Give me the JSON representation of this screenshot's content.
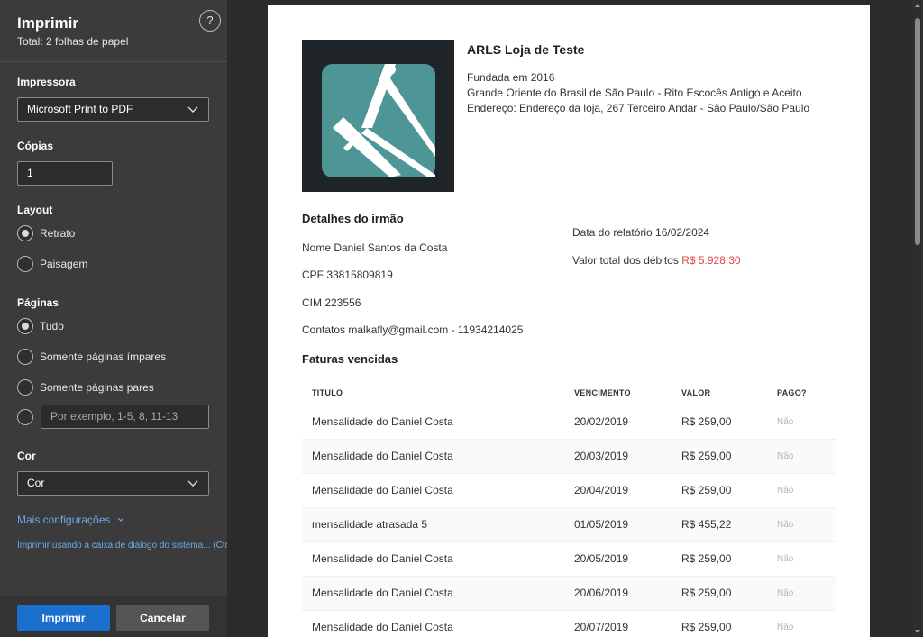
{
  "panel": {
    "title": "Imprimir",
    "subtitle": "Total: 2 folhas de papel",
    "help_icon": "?",
    "printer_label": "Impressora",
    "printer_value": "Microsoft Print to PDF",
    "copies_label": "Cópias",
    "copies_value": "1",
    "layout_label": "Layout",
    "layout_options": [
      "Retrato",
      "Paisagem"
    ],
    "layout_selected": "Retrato",
    "pages_label": "Páginas",
    "pages_options": [
      "Tudo",
      "Somente páginas ímpares",
      "Somente páginas pares"
    ],
    "pages_selected": "Tudo",
    "pages_custom_placeholder": "Por exemplo, 1-5, 8, 11-13",
    "color_label": "Cor",
    "color_value": "Cor",
    "more_settings": "Mais configurações",
    "system_dialog_link": "Imprimir usando a caixa de diálogo do sistema... (Ctrl+Shift+P)",
    "print_button": "Imprimir",
    "cancel_button": "Cancelar"
  },
  "document": {
    "org_name": "ARLS Loja de Teste",
    "founded": "Fundada em 2016",
    "obedience": "Grande Oriente do Brasil de São Paulo - Rito Escocês Antigo e Aceito",
    "address": "Endereço: Endereço da loja, 267 Terceiro Andar - São Paulo/São Paulo",
    "details_title": "Detalhes do irmão",
    "name": "Nome Daniel Santos da Costa",
    "cpf": "CPF 33815809819",
    "cim": "CIM 223556",
    "contacts": "Contatos malkafly@gmail.com - 11934214025",
    "report_date": "Data do relatório 16/02/2024",
    "total_debts_label": "Valor total dos débitos",
    "total_debts_value": "R$ 5.928,30",
    "overdue_title": "Faturas vencidas",
    "table": {
      "headers": [
        "TITULO",
        "VENCIMENTO",
        "VALOR",
        "PAGO?"
      ],
      "rows": [
        [
          "Mensalidade do Daniel Costa",
          "20/02/2019",
          "R$ 259,00",
          "Não"
        ],
        [
          "Mensalidade do Daniel Costa",
          "20/03/2019",
          "R$ 259,00",
          "Não"
        ],
        [
          "Mensalidade do Daniel Costa",
          "20/04/2019",
          "R$ 259,00",
          "Não"
        ],
        [
          "mensalidade atrasada 5",
          "01/05/2019",
          "R$ 455,22",
          "Não"
        ],
        [
          "Mensalidade do Daniel Costa",
          "20/05/2019",
          "R$ 259,00",
          "Não"
        ],
        [
          "Mensalidade do Daniel Costa",
          "20/06/2019",
          "R$ 259,00",
          "Não"
        ],
        [
          "Mensalidade do Daniel Costa",
          "20/07/2019",
          "R$ 259,00",
          "Não"
        ]
      ]
    }
  },
  "colors": {
    "panel_bg": "#3b3b3b",
    "accent": "#1a6fcf",
    "link": "#6ea8e6",
    "debt_red": "#e04646",
    "logo_teal": "#4e9696"
  }
}
